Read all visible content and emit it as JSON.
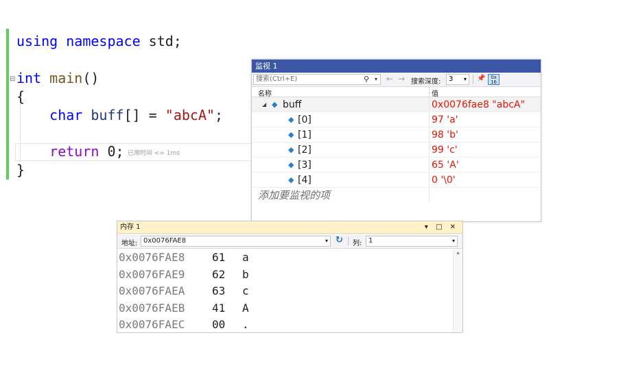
{
  "editor": {
    "line1": {
      "kw1": "using",
      "kw2": "namespace",
      "rest": " std;"
    },
    "line2": {
      "type": "int",
      "fn": "main",
      "parens": "()"
    },
    "line3": {
      "brace": "{"
    },
    "line4": {
      "type": "char",
      "var": "buff",
      "mid": "[] = ",
      "str": "\"abcA\"",
      "end": ";"
    },
    "line5": {
      "kw": "return",
      "rest": " 0;"
    },
    "line6": {
      "brace": "}"
    },
    "elapsed_hint": "已用时间 <= 1ms"
  },
  "watch": {
    "title": "监视 1",
    "search_placeholder": "搜索(Ctrl+E)",
    "depth_label": "搜索深度:",
    "depth_value": "3",
    "hex_icon_label": "0x 16",
    "col_name": "名称",
    "col_value": "值",
    "root": {
      "name": "buff",
      "value": "0x0076fae8 \"abcA\""
    },
    "children": [
      {
        "name": "[0]",
        "value": "97 'a'"
      },
      {
        "name": "[1]",
        "value": "98 'b'"
      },
      {
        "name": "[2]",
        "value": "99 'c'"
      },
      {
        "name": "[3]",
        "value": "65 'A'"
      },
      {
        "name": "[4]",
        "value": "0 '\\0'"
      }
    ],
    "add_item": "添加要监视的项"
  },
  "memory": {
    "title": "内存 1",
    "window_controls": "▾ □ ✕",
    "address_label": "地址:",
    "address_value": "0x0076FAE8",
    "columns_label": "列:",
    "columns_value": "1",
    "rows": [
      {
        "addr": "0x0076FAE8",
        "byte": "61",
        "char": "a"
      },
      {
        "addr": "0x0076FAE9",
        "byte": "62",
        "char": "b"
      },
      {
        "addr": "0x0076FAEA",
        "byte": "63",
        "char": "c"
      },
      {
        "addr": "0x0076FAEB",
        "byte": "41",
        "char": "A"
      },
      {
        "addr": "0x0076FAEC",
        "byte": "00",
        "char": "."
      }
    ]
  },
  "colors": {
    "change_bar": "#5fcd5f",
    "watch_title_bg": "#3c56a6",
    "memory_title_bg": "#fff1c8",
    "value_red": "#e51400"
  }
}
